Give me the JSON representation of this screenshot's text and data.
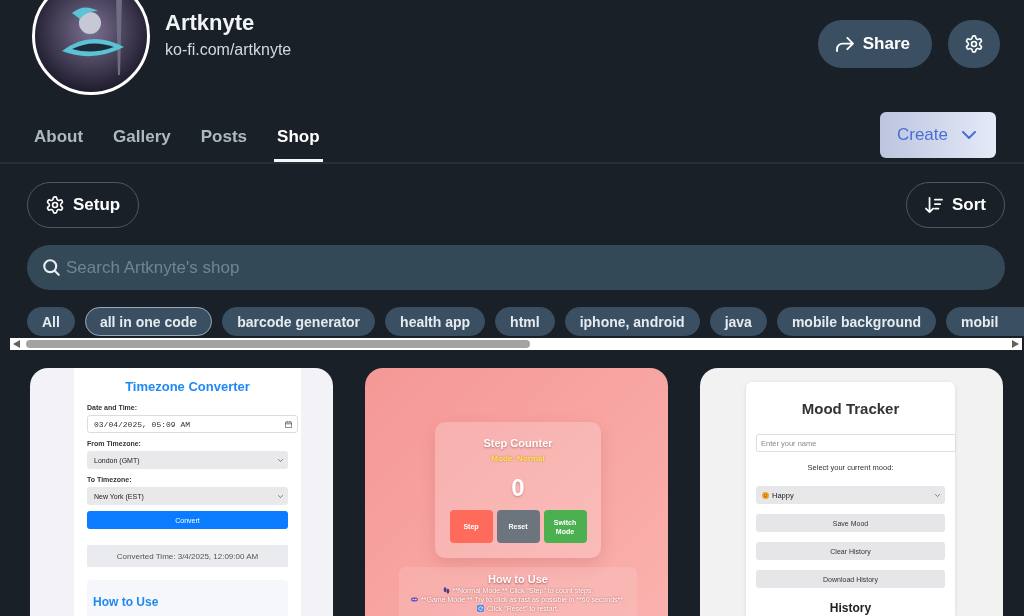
{
  "profile": {
    "name": "Artknyte",
    "url": "ko-fi.com/artknyte"
  },
  "header_actions": {
    "share_label": "Share"
  },
  "tabs": [
    {
      "label": "About",
      "selected": false
    },
    {
      "label": "Gallery",
      "selected": false
    },
    {
      "label": "Posts",
      "selected": false
    },
    {
      "label": "Shop",
      "selected": true
    }
  ],
  "create_button": {
    "label": "Create"
  },
  "toolbar": {
    "setup_label": "Setup",
    "sort_label": "Sort"
  },
  "search": {
    "placeholder": "Search Artknyte's shop"
  },
  "filters": [
    {
      "label": "All",
      "selected": false
    },
    {
      "label": "all in one code",
      "selected": true
    },
    {
      "label": "barcode generator",
      "selected": false
    },
    {
      "label": "health app",
      "selected": false
    },
    {
      "label": "html",
      "selected": false
    },
    {
      "label": "iphone, android",
      "selected": false
    },
    {
      "label": "java",
      "selected": false
    },
    {
      "label": "mobile background",
      "selected": false
    },
    {
      "label": "mobil",
      "selected": false
    }
  ],
  "products": [
    {
      "kind": "timezone_converter",
      "title": "Timezone Converter",
      "fields": [
        {
          "kind": "date",
          "label": "Date and Time:",
          "value": "03/04/2025, 05:09 AM"
        },
        {
          "kind": "select",
          "label": "From Timezone:",
          "value": "London (GMT)"
        },
        {
          "kind": "select",
          "label": "To Timezone:",
          "value": "New York (EST)"
        }
      ],
      "button": "Convert",
      "result": "Converted Time: 3/4/2025, 12:09:00 AM",
      "help_title": "How to Use"
    },
    {
      "kind": "step_counter",
      "title": "Step Counter",
      "mode": "Mode: Normal",
      "count": "0",
      "buttons": [
        {
          "label": "Step",
          "color": "#ff6b5b"
        },
        {
          "label": "Reset",
          "color": "#6c757d"
        },
        {
          "label": "Switch Mode",
          "color": "#4caf50"
        }
      ],
      "help_title": "How to Use",
      "help_lines": [
        {
          "kind": "footprints",
          "text": "**Normal Mode:** Click \"Step\" to count steps."
        },
        {
          "kind": "gamepad",
          "text": "**Game Mode:** Try to click as fast as possible in **60 seconds**."
        },
        {
          "kind": "refresh",
          "text": "Click \"Reset\" to restart."
        }
      ]
    },
    {
      "kind": "mood_tracker",
      "title": "Mood Tracker",
      "name_placeholder": "Enter your name",
      "prompt": "Select your current mood:",
      "mood": "Happy",
      "buttons": [
        "Save Mood",
        "Clear History",
        "Download History"
      ],
      "history_title": "History"
    }
  ]
}
